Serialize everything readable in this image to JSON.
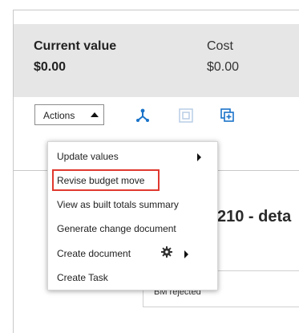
{
  "summary": {
    "current_value_label": "Current value",
    "current_value": "$0.00",
    "cost_label": "Cost",
    "cost_value": "$0.00"
  },
  "toolbar": {
    "actions_label": "Actions"
  },
  "menu": {
    "items": [
      {
        "label": "Update values",
        "has_submenu": true
      },
      {
        "label": "Revise budget move",
        "highlighted": true
      },
      {
        "label": "View as built totals summary"
      },
      {
        "label": "Generate change document"
      },
      {
        "label": "Create document",
        "has_submenu": true,
        "icon": "gear-icon"
      },
      {
        "label": "Create Task"
      }
    ]
  },
  "detail": {
    "title": "210 - deta"
  },
  "table": {
    "cell_text": "BM rejected"
  },
  "colors": {
    "summary_bg": "#e6e6e6",
    "accent_blue": "#1a73c9",
    "highlight_red": "#e0392f"
  }
}
